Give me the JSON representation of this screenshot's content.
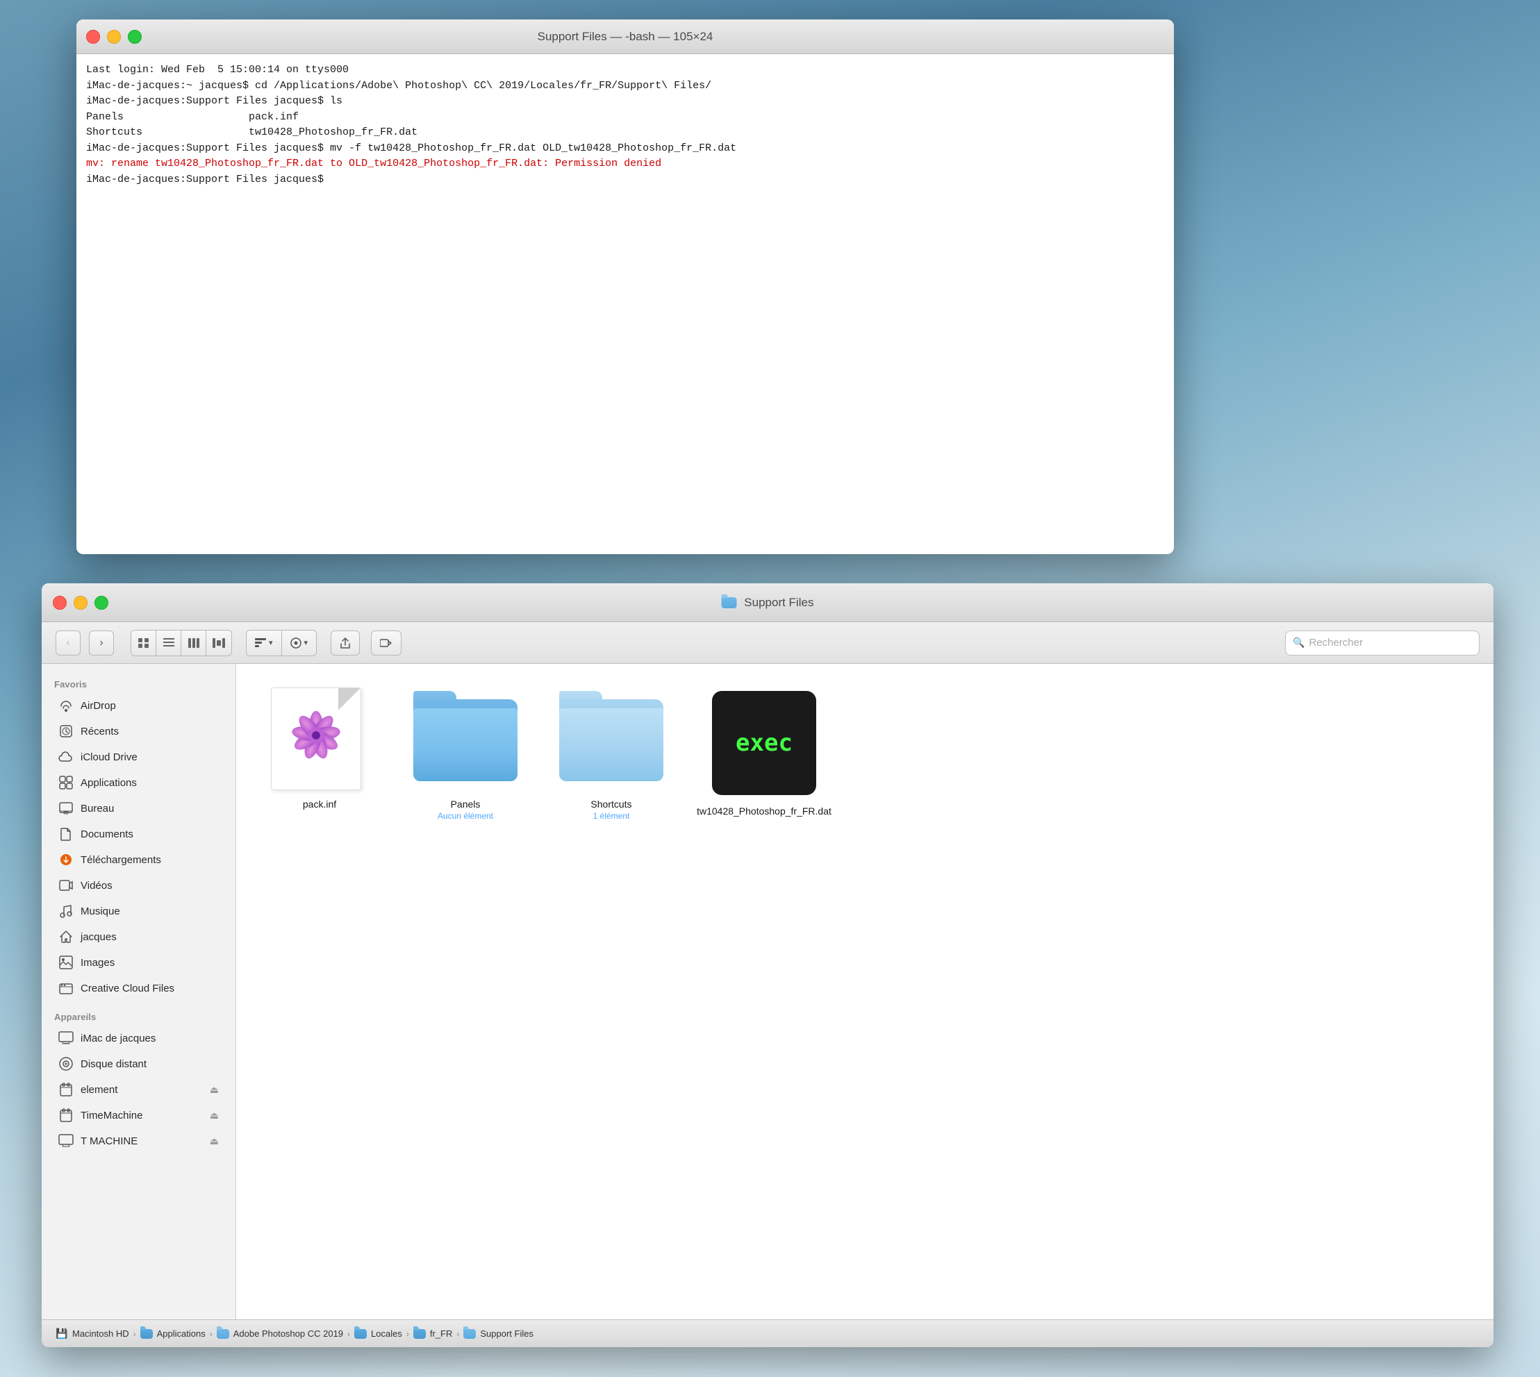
{
  "terminal": {
    "title": "Support Files — -bash — 105×24",
    "lines": [
      "Last login: Wed Feb  5 15:00:14 on ttys000",
      "iMac-de-jacques:~ jacques$ cd /Applications/Adobe\\ Photoshop\\ CC\\ 2019/Locales/fr_FR/Support\\ Files/",
      "iMac-de-jacques:Support Files jacques$ ls",
      "Panels                    pack.inf",
      "Shortcuts                 tw10428_Photoshop_fr_FR.dat",
      "iMac-de-jacques:Support Files jacques$ mv -f tw10428_Photoshop_fr_FR.dat OLD_tw10428_Photoshop_fr_FR.dat",
      "mv: rename tw10428_Photoshop_fr_FR.dat to OLD_tw10428_Photoshop_fr_FR.dat: Permission denied",
      "iMac-de-jacques:Support Files jacques$ "
    ],
    "error_line": 6
  },
  "finder": {
    "title": "Support Files",
    "toolbar": {
      "search_placeholder": "Rechercher"
    },
    "sidebar": {
      "sections": [
        {
          "label": "Favoris",
          "items": [
            {
              "id": "airdrop",
              "label": "AirDrop",
              "icon": "airdrop"
            },
            {
              "id": "recents",
              "label": "Récents",
              "icon": "recents"
            },
            {
              "id": "icloud",
              "label": "iCloud Drive",
              "icon": "icloud"
            },
            {
              "id": "applications",
              "label": "Applications",
              "icon": "applications"
            },
            {
              "id": "bureau",
              "label": "Bureau",
              "icon": "bureau"
            },
            {
              "id": "documents",
              "label": "Documents",
              "icon": "documents"
            },
            {
              "id": "telechargements",
              "label": "Téléchargements",
              "icon": "telechargements"
            },
            {
              "id": "videos",
              "label": "Vidéos",
              "icon": "videos"
            },
            {
              "id": "musique",
              "label": "Musique",
              "icon": "musique"
            },
            {
              "id": "jacques",
              "label": "jacques",
              "icon": "home"
            },
            {
              "id": "images",
              "label": "Images",
              "icon": "images"
            },
            {
              "id": "creative",
              "label": "Creative Cloud Files",
              "icon": "creative"
            }
          ]
        },
        {
          "label": "Appareils",
          "items": [
            {
              "id": "imac",
              "label": "iMac de jacques",
              "icon": "imac",
              "eject": false
            },
            {
              "id": "disque",
              "label": "Disque distant",
              "icon": "disque",
              "eject": false
            },
            {
              "id": "element",
              "label": "element",
              "icon": "element",
              "eject": true
            },
            {
              "id": "timemachine",
              "label": "TimeMachine",
              "icon": "timemachine",
              "eject": true
            },
            {
              "id": "tmachine",
              "label": "T MACHINE",
              "icon": "tmachine",
              "eject": true
            }
          ]
        }
      ]
    },
    "files": [
      {
        "id": "pack",
        "name": "pack.inf",
        "type": "file",
        "subtitle": ""
      },
      {
        "id": "panels",
        "name": "Panels",
        "type": "folder",
        "subtitle": "Aucun élément"
      },
      {
        "id": "shortcuts",
        "name": "Shortcuts",
        "type": "folder-light",
        "subtitle": "1 élément"
      },
      {
        "id": "tw10428",
        "name": "tw10428_Photoshop_fr_FR.dat",
        "type": "exec",
        "subtitle": ""
      }
    ],
    "breadcrumb": [
      {
        "label": "Macintosh HD",
        "type": "disk"
      },
      {
        "label": "Applications",
        "type": "folder"
      },
      {
        "label": "Adobe Photoshop CC 2019",
        "type": "folder-blue"
      },
      {
        "label": "Locales",
        "type": "folder"
      },
      {
        "label": "fr_FR",
        "type": "folder"
      },
      {
        "label": "Support Files",
        "type": "folder-blue"
      }
    ]
  }
}
